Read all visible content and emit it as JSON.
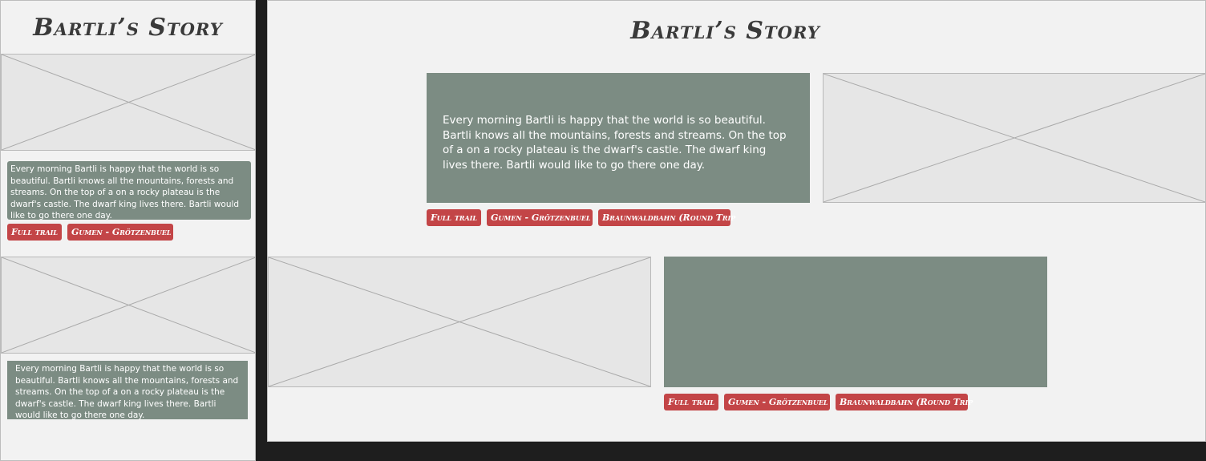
{
  "mobile": {
    "title": "Bartli’s Story",
    "sections": [
      {
        "text": "Every morning Bartli is happy that the world is so beautiful. Bartli knows all the mountains, forests and streams. On the top of a on a rocky plateau is the dwarf's castle. The dwarf king lives there. Bartli would like to go there one day.",
        "tags": [
          "Full trail",
          "Gumen - Grötzenbuel"
        ]
      },
      {
        "text": "Every morning Bartli is happy that the world is so beautiful. Bartli knows all the mountains, forests and streams. On the top of a on a rocky plateau is the dwarf's castle. The dwarf king lives there. Bartli would like to go there one day.",
        "tags": []
      }
    ]
  },
  "desktop": {
    "title": "Bartli’s Story",
    "sections": [
      {
        "text": "Every morning Bartli is happy that the world is so beautiful. Bartli knows all the mountains, forests and streams. On the top of a on a rocky plateau is the dwarf's castle. The dwarf king lives there. Bartli would like to go there one day.",
        "tags": [
          "Full trail",
          "Gumen - Grötzenbuel",
          "Braunwaldbahn (Round Trip"
        ]
      },
      {
        "text": "",
        "tags": [
          "Full trail",
          "Gumen - Grötzenbuel",
          "Braunwaldbahn (Round Trip"
        ]
      }
    ]
  },
  "colors": {
    "page_background": "#1e1e1e",
    "frame_background": "#f2f2f2",
    "placeholder_fill": "#e6e6e6",
    "text_card": "#7c8c83",
    "tag": "#c34547",
    "title_text": "#3a3a3a"
  }
}
